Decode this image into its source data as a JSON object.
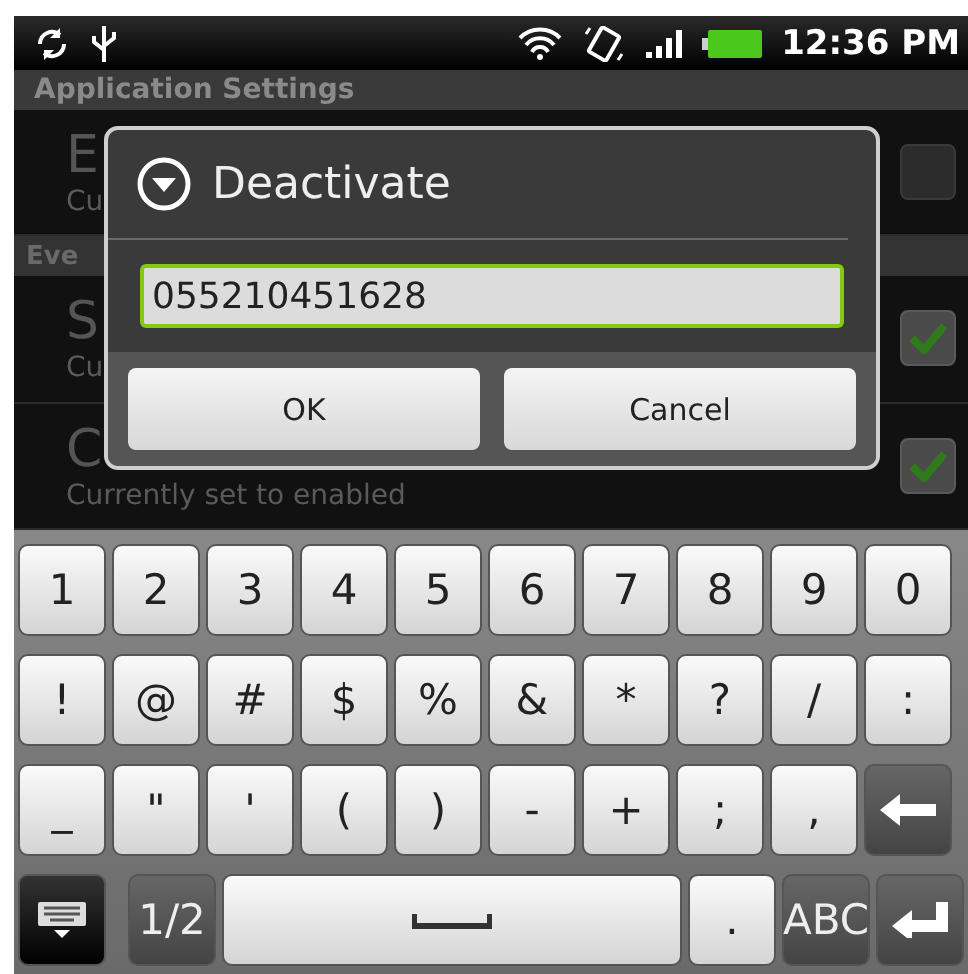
{
  "status_bar": {
    "time": "12:36 PM"
  },
  "background": {
    "section_header": "Application Settings",
    "items": [
      {
        "kind": "item",
        "title": "E",
        "summary": "Cu",
        "checked": false
      },
      {
        "kind": "header",
        "title": "Eve"
      },
      {
        "kind": "item",
        "title": "S",
        "summary": "Cu",
        "checked": true
      },
      {
        "kind": "item",
        "title": "C",
        "summary": "Currently set to enabled",
        "checked": true
      }
    ]
  },
  "dialog": {
    "title": "Deactivate",
    "input_value": "055210451628",
    "buttons": [
      "OK",
      "Cancel"
    ]
  },
  "keyboard": {
    "rows": [
      [
        {
          "kind": "char",
          "label": "1"
        },
        {
          "kind": "char",
          "label": "2"
        },
        {
          "kind": "char",
          "label": "3"
        },
        {
          "kind": "char",
          "label": "4"
        },
        {
          "kind": "char",
          "label": "5"
        },
        {
          "kind": "char",
          "label": "6"
        },
        {
          "kind": "char",
          "label": "7"
        },
        {
          "kind": "char",
          "label": "8"
        },
        {
          "kind": "char",
          "label": "9"
        },
        {
          "kind": "char",
          "label": "0"
        }
      ],
      [
        {
          "kind": "char",
          "label": "!"
        },
        {
          "kind": "char",
          "label": "@"
        },
        {
          "kind": "char",
          "label": "#"
        },
        {
          "kind": "char",
          "label": "$"
        },
        {
          "kind": "char",
          "label": "%"
        },
        {
          "kind": "char",
          "label": "&"
        },
        {
          "kind": "char",
          "label": "*"
        },
        {
          "kind": "char",
          "label": "?"
        },
        {
          "kind": "char",
          "label": "/"
        },
        {
          "kind": "char",
          "label": ":"
        }
      ],
      [
        {
          "kind": "char",
          "label": "_"
        },
        {
          "kind": "char",
          "label": "\""
        },
        {
          "kind": "char",
          "label": "'"
        },
        {
          "kind": "char",
          "label": "("
        },
        {
          "kind": "char",
          "label": ")"
        },
        {
          "kind": "char",
          "label": "-"
        },
        {
          "kind": "char",
          "label": "+"
        },
        {
          "kind": "char",
          "label": ";"
        },
        {
          "kind": "char",
          "label": ","
        },
        {
          "kind": "backspace"
        }
      ]
    ],
    "bottom_row": [
      {
        "kind": "hide"
      },
      {
        "kind": "mod",
        "label": "1/2"
      },
      {
        "kind": "space"
      },
      {
        "kind": "char",
        "label": "."
      },
      {
        "kind": "mod",
        "label": "ABC"
      },
      {
        "kind": "enter"
      }
    ]
  }
}
